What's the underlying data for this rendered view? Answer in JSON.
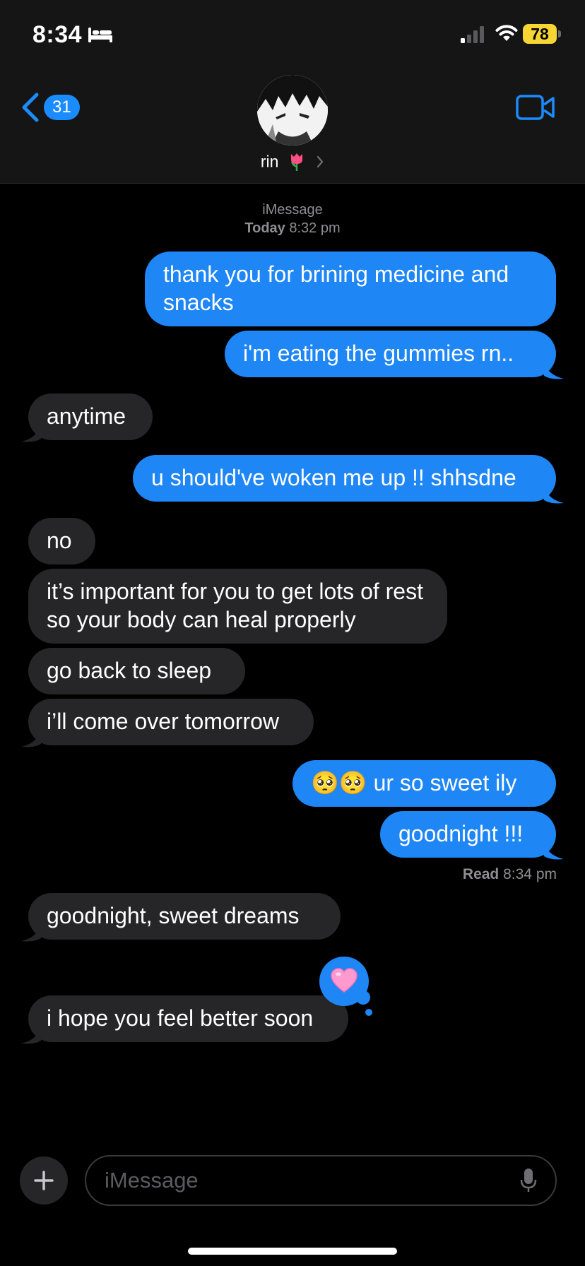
{
  "status_bar": {
    "time": "8:34",
    "battery": "78",
    "battery_color": "#f7d634"
  },
  "header": {
    "back_count": "31",
    "contact_name": "rin",
    "avatar_icon": "avatar-photo",
    "name_emoji_icon": "tulip-icon",
    "video_icon": "video-camera-icon"
  },
  "conversation": {
    "service_label": "iMessage",
    "date_label": "Today",
    "time_label": "8:32 pm",
    "messages": [
      {
        "direction": "sent",
        "text": "thank you for brining medicine and snacks"
      },
      {
        "direction": "sent",
        "text": "i'm eating the gummies rn.."
      },
      {
        "direction": "received",
        "text": "anytime"
      },
      {
        "direction": "sent",
        "text": "u should've woken me up !! shhsdne"
      },
      {
        "direction": "received",
        "text": "no"
      },
      {
        "direction": "received",
        "text": "it’s important for you to get lots of rest so your body can heal properly"
      },
      {
        "direction": "received",
        "text": "go back to sleep"
      },
      {
        "direction": "received",
        "text": "i’ll come over tomorrow"
      },
      {
        "direction": "sent",
        "text": "🥺🥺 ur so sweet ily"
      },
      {
        "direction": "sent",
        "text": "goodnight !!!"
      },
      {
        "direction": "received",
        "text": "goodnight, sweet dreams"
      },
      {
        "direction": "received",
        "text": "i hope you feel better soon"
      }
    ],
    "read_label": "Read",
    "read_time": "8:34 pm",
    "tapback_icon": "pink-heart-icon"
  },
  "input": {
    "placeholder": "iMessage"
  },
  "colors": {
    "sent_bubble": "#1e86f5",
    "received_bubble": "#262629",
    "accent": "#1a8cff"
  }
}
